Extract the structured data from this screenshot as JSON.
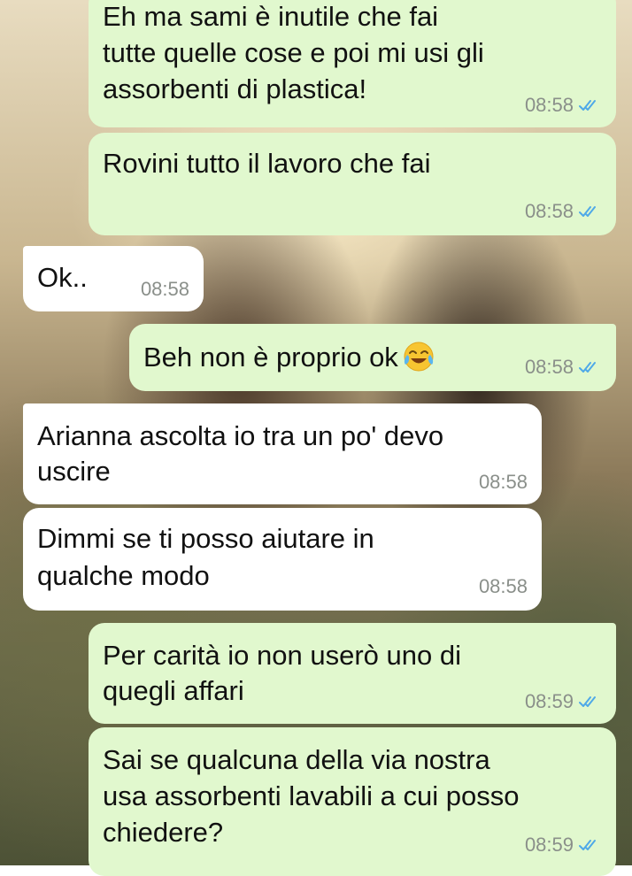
{
  "messages": [
    {
      "id": "m1",
      "direction": "outgoing",
      "lines": [
        "Eh ma sami è inutile che fai",
        "tutte quelle cose e poi mi usi gli",
        "assorbenti di plastica!"
      ],
      "time": "08:58",
      "read": true
    },
    {
      "id": "m2",
      "direction": "outgoing",
      "lines": [
        "Rovini tutto il lavoro che fai"
      ],
      "time": "08:58",
      "read": true
    },
    {
      "id": "m3",
      "direction": "incoming",
      "lines": [
        "Ok.."
      ],
      "time": "08:58"
    },
    {
      "id": "m4",
      "direction": "outgoing",
      "lines": [
        "Beh non è proprio ok"
      ],
      "emoji": "face-with-tears-of-joy",
      "time": "08:58",
      "read": true
    },
    {
      "id": "m5",
      "direction": "incoming",
      "lines": [
        "Arianna ascolta io tra un po' devo",
        "uscire"
      ],
      "time": "08:58"
    },
    {
      "id": "m6",
      "direction": "incoming",
      "lines": [
        "Dimmi se ti posso aiutare in",
        "qualche modo"
      ],
      "time": "08:58"
    },
    {
      "id": "m7",
      "direction": "outgoing",
      "lines": [
        "Per carità io non userò uno di",
        "quegli affari"
      ],
      "time": "08:59",
      "read": true
    },
    {
      "id": "m8",
      "direction": "outgoing",
      "lines": [
        "Sai se qualcuna della via nostra",
        "usa assorbenti lavabili a cui posso",
        "chiedere?"
      ],
      "time": "08:59",
      "read": true
    }
  ],
  "colors": {
    "outgoing_bubble": "#e1f8ce",
    "incoming_bubble": "#ffffff",
    "read_ticks": "#4fa9e8",
    "timestamp": "#8a8f8a"
  }
}
